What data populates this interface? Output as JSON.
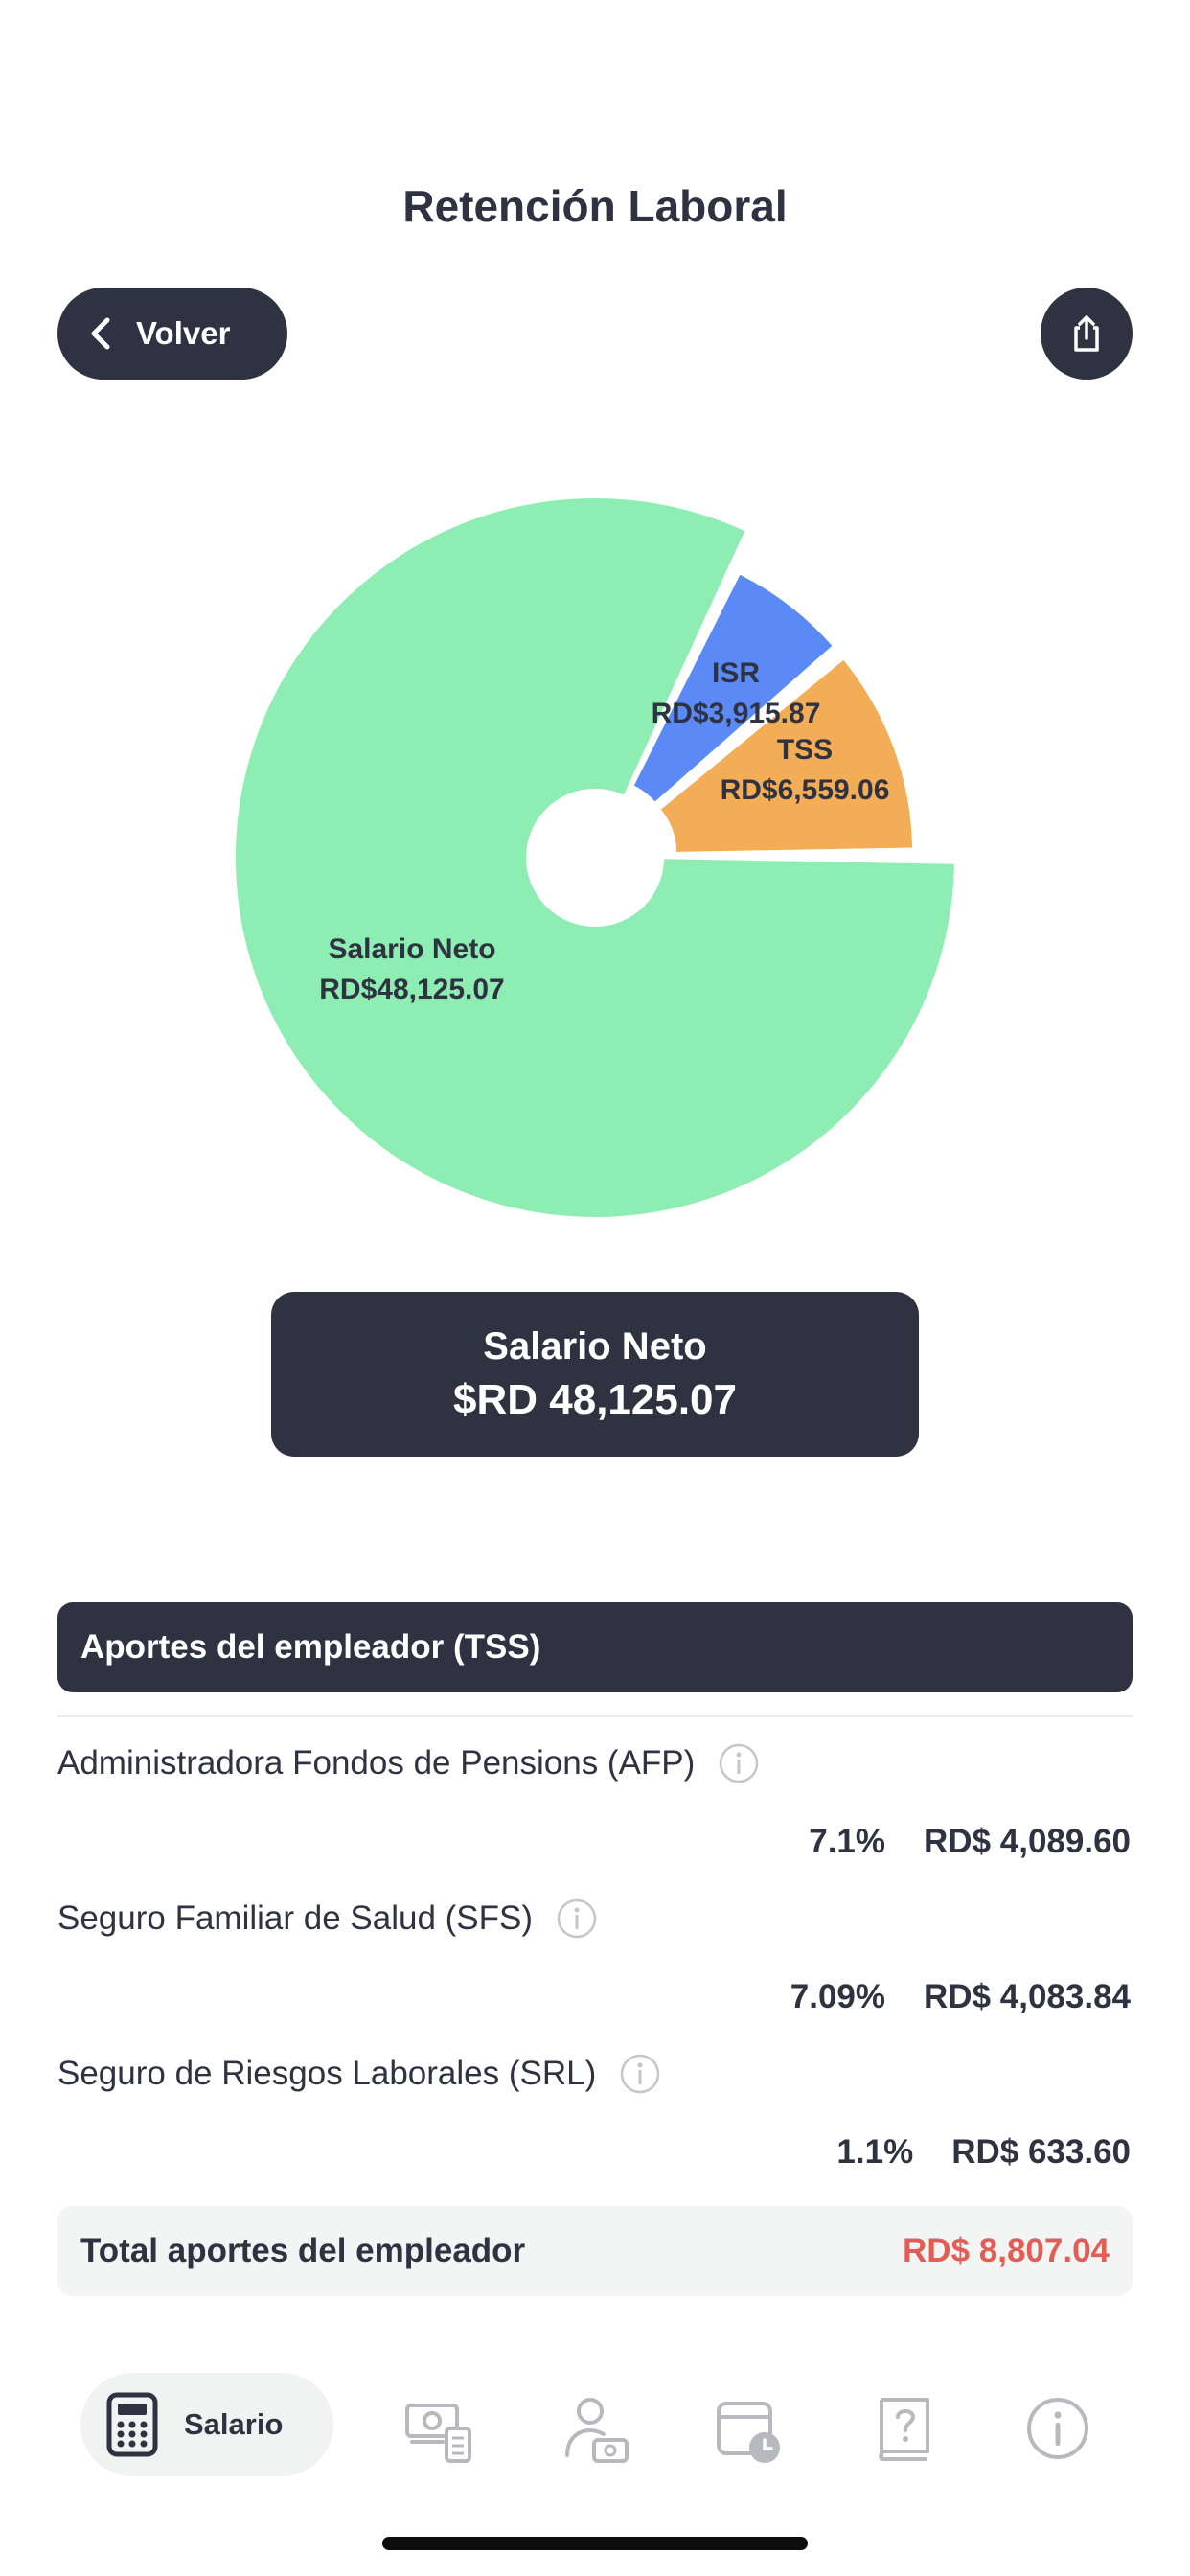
{
  "header": {
    "title": "Retención Laboral",
    "back_label": "Volver",
    "share_icon": "share-icon"
  },
  "chart_data": {
    "type": "pie",
    "slices": [
      {
        "name": "Salario Neto",
        "label": "Salario Neto",
        "value_label": "RD$48,125.07",
        "value": 48125.07,
        "color": "#8eedb2"
      },
      {
        "name": "ISR",
        "label": "ISR",
        "value_label": "RD$3,915.87",
        "value": 3915.87,
        "color": "#5b8af6"
      },
      {
        "name": "TSS",
        "label": "TSS",
        "value_label": "RD$6,559.06",
        "value": 6559.06,
        "color": "#f2ad56"
      }
    ]
  },
  "net_salary": {
    "label": "Salario Neto",
    "amount": "$RD 48,125.07"
  },
  "employer": {
    "header": "Aportes del empleador (TSS)",
    "items": [
      {
        "name": "Administradora Fondos de Pensions (AFP)",
        "percent": "7.1%",
        "amount": "RD$ 4,089.60"
      },
      {
        "name": "Seguro Familiar de Salud (SFS)",
        "percent": "7.09%",
        "amount": "RD$ 4,083.84"
      },
      {
        "name": "Seguro de Riesgos Laborales (SRL)",
        "percent": "1.1%",
        "amount": "RD$ 633.60"
      }
    ],
    "total_label": "Total aportes del empleador",
    "total_amount": "RD$ 8,807.04",
    "total_color": "#e35d55"
  },
  "tabbar": {
    "active_label": "Salario",
    "icons": [
      "calculator-icon",
      "money-calculator-icon",
      "person-money-icon",
      "calendar-clock-icon",
      "question-book-icon",
      "info-icon"
    ]
  },
  "colors": {
    "dark": "#2f3240",
    "accent_red": "#e35d55"
  }
}
